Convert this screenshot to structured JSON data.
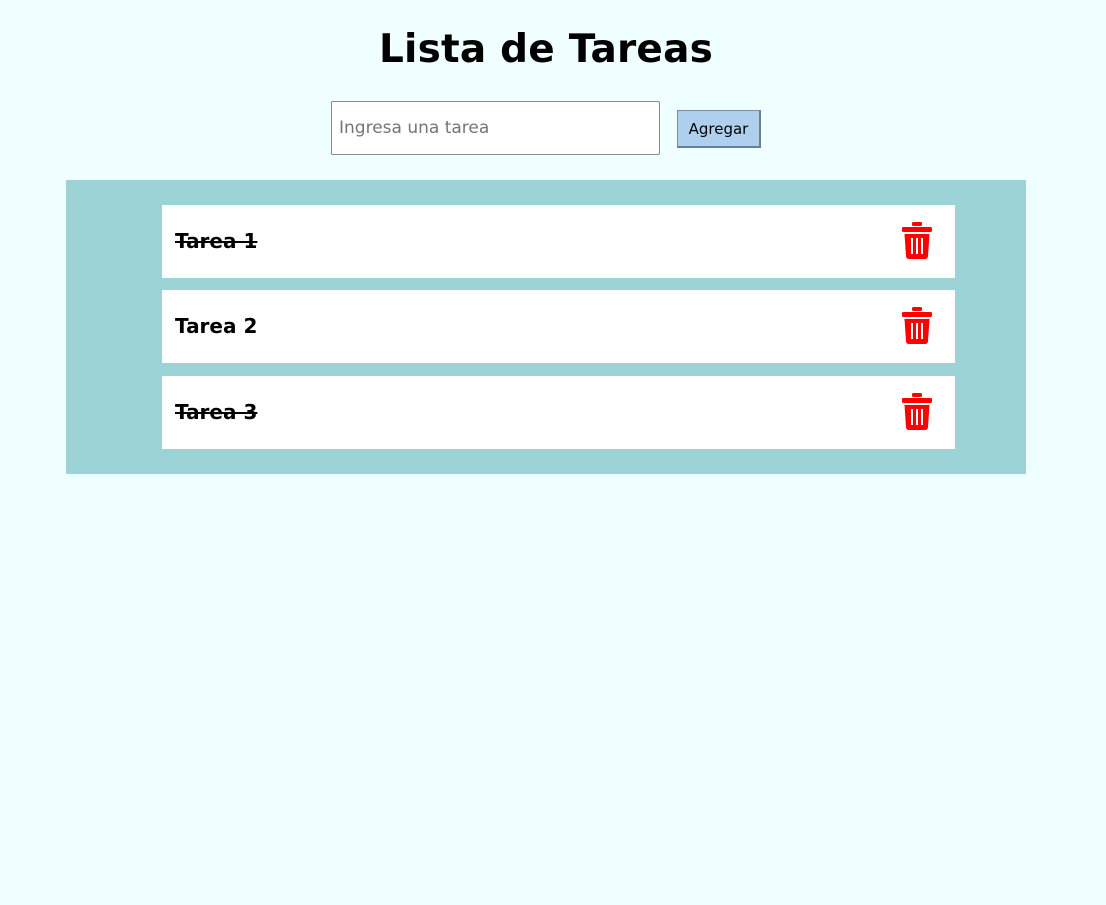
{
  "header": {
    "title": "Lista de Tareas"
  },
  "form": {
    "input_value": "",
    "input_placeholder": "Ingresa una tarea",
    "add_label": "Agregar"
  },
  "tasks": [
    {
      "label": "Tarea 1",
      "completed": true
    },
    {
      "label": "Tarea 2",
      "completed": false
    },
    {
      "label": "Tarea 3",
      "completed": true
    }
  ],
  "icons": {
    "delete": "trash-icon"
  },
  "colors": {
    "background": "#f0ffff",
    "panel": "#9bd3d6",
    "button": "#aed0ee",
    "delete_icon": "#ff0000"
  }
}
